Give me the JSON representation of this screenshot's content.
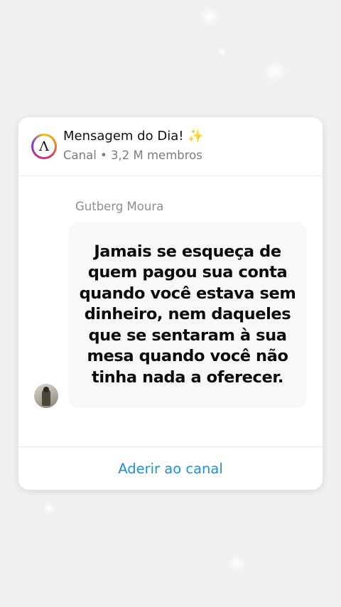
{
  "channel": {
    "logo_letter": "Λ",
    "title": "Mensagem do Dia! ✨",
    "subtitle": "Canal • 3,2 M membros"
  },
  "message": {
    "sender": "Gutberg Moura",
    "text": "Jamais se esqueça de quem pagou sua conta quando você estava sem dinheiro, nem daqueles que se sentaram à sua mesa quando você não tinha nada a oferecer."
  },
  "actions": {
    "join_label": "Aderir ao canal"
  },
  "colors": {
    "background": "#f0f0f1",
    "card": "#ffffff",
    "bubble": "#f7f8f8",
    "link": "#1b93d1",
    "secondary_text": "#7c7c7c"
  }
}
